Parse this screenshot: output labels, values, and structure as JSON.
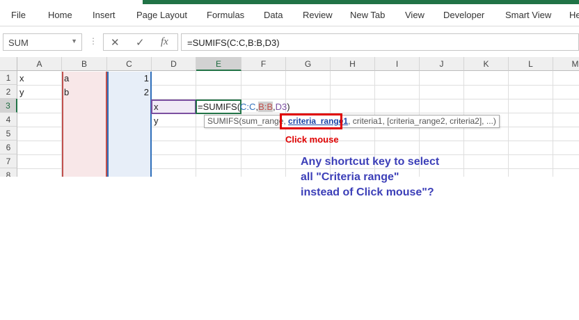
{
  "ribbon": {
    "tabs": [
      "File",
      "Home",
      "Insert",
      "Page Layout",
      "Formulas",
      "Data",
      "Review",
      "New Tab",
      "View",
      "Developer",
      "Smart View",
      "He"
    ]
  },
  "formula_bar": {
    "name_box": "SUM",
    "cancel_icon": "✕",
    "enter_icon": "✓",
    "fx_label": "fx",
    "formula": "=SUMIFS(C:C,B:B,D3)"
  },
  "grid": {
    "columns": [
      "A",
      "B",
      "C",
      "D",
      "E",
      "F",
      "G",
      "H",
      "I",
      "J",
      "K",
      "L",
      "M"
    ],
    "rows": [
      "1",
      "2",
      "3",
      "4",
      "5",
      "6",
      "7",
      "8"
    ],
    "cells": {
      "A1": "x",
      "A2": "y",
      "B1": "a",
      "B2": "b",
      "C1": "1",
      "C2": "2",
      "D3": "x",
      "D4": "y"
    },
    "in_cell_formula": {
      "prefix": "=SUMIFS(",
      "ref_c": "C:C",
      "comma1": ",",
      "ref_b": "B:B",
      "comma2": ",",
      "ref_d": "D3",
      "suffix": ")"
    }
  },
  "tooltip": {
    "prefix": "SUMIFS(sum_range, ",
    "highlight": "criteria_range1",
    "suffix": ", criteria1, [criteria_range2, criteria2], ...)"
  },
  "annotations": {
    "click_mouse": "Click mouse",
    "question_lines": [
      "Any shortcut key to select",
      "all \"Criteria range\"",
      "instead of Click mouse\"?"
    ]
  },
  "colors": {
    "excel_green": "#217346",
    "ref_c_blue": "#2f6fba",
    "ref_b_red": "#c0504d",
    "ref_d_purple": "#7b4fa0",
    "annotation_red": "#e00000",
    "annotation_blue": "#3c3fb8"
  }
}
